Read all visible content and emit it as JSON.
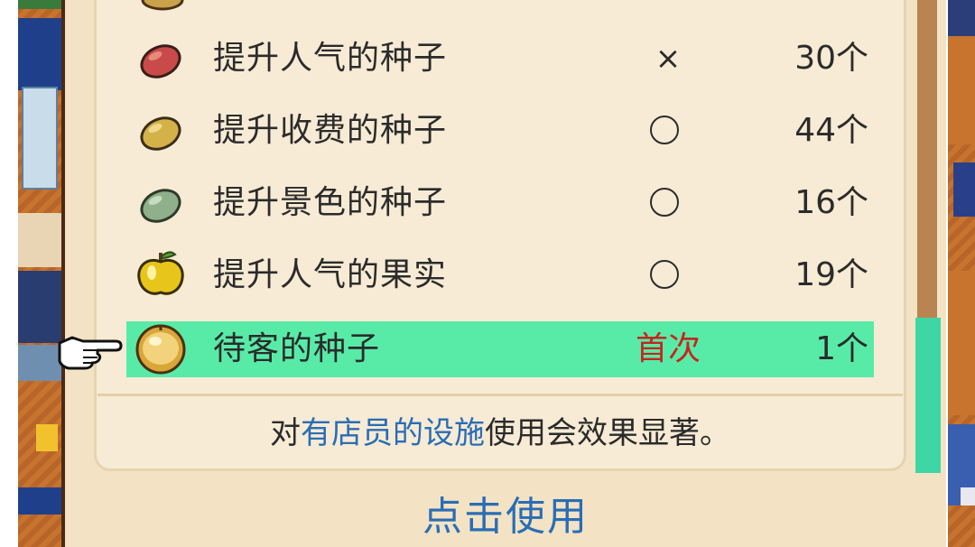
{
  "items": [
    {
      "name": "提升人气的种子",
      "mark": "×",
      "count": "30个",
      "icon": "red-seed-icon",
      "color": "#c84a4a"
    },
    {
      "name": "提升收费的种子",
      "mark": "circle",
      "count": "44个",
      "icon": "yellow-seed-icon",
      "color": "#d4b24a"
    },
    {
      "name": "提升景色的种子",
      "mark": "circle",
      "count": "16个",
      "icon": "green-seed-icon",
      "color": "#8fb08a"
    },
    {
      "name": "提升人气的果实",
      "mark": "circle",
      "count": "19个",
      "icon": "yellow-fruit-icon",
      "color": "#e8c51a"
    },
    {
      "name": "待客的种子",
      "mark": "首次",
      "count": "1个",
      "icon": "gold-fruit-icon",
      "color": "#d9a63a",
      "selected": true
    }
  ],
  "hint": {
    "pre": "对",
    "highlight": "有店员的设施",
    "post": "使用会效果显著。"
  },
  "use_button": "点击使用",
  "colors": {
    "selected_row": "#58eba8",
    "accent_blue": "#2a6db5",
    "first_red": "#c4261e",
    "panel": "#f7ebd5"
  }
}
